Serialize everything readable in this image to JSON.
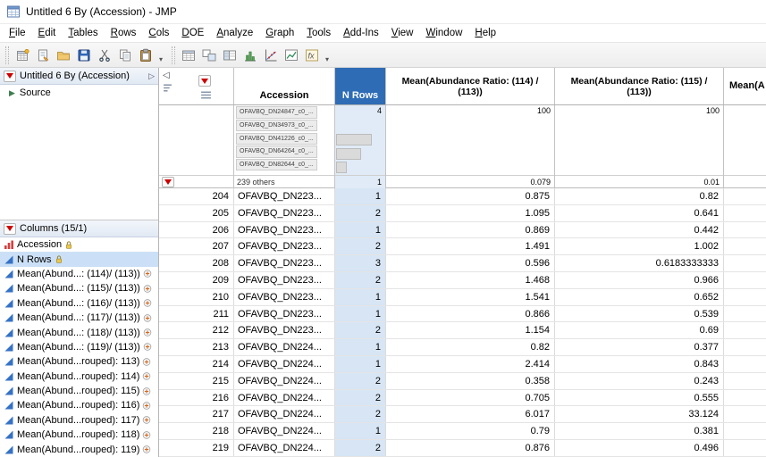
{
  "window": {
    "title": "Untitled 6 By (Accession) - JMP"
  },
  "menu": {
    "items": [
      "File",
      "Edit",
      "Tables",
      "Rows",
      "Cols",
      "DOE",
      "Analyze",
      "Graph",
      "Tools",
      "Add-Ins",
      "View",
      "Window",
      "Help"
    ]
  },
  "toolbar": {
    "group1": [
      "new-data-table",
      "new-journal",
      "open",
      "save",
      "cut",
      "copy",
      "paste"
    ],
    "group2": [
      "data-table",
      "join-tables",
      "split-columns",
      "distribution",
      "fit-y-by-x",
      "graph-builder",
      "formula"
    ]
  },
  "icons": {
    "collapse_left": "◁",
    "panel_collapse_right": "▷",
    "overflow_chevron": "▾",
    "source_marker": "▶"
  },
  "colors": {
    "nrows_header": "#2e6cb5",
    "nrows_column_bg": "#d7e5f4",
    "selection_bg": "#cbe0f6",
    "red_triangle": "#cc0000"
  },
  "sidebar": {
    "table_panel": {
      "title": "Untitled 6 By (Accession)",
      "source_label": "Source"
    },
    "columns_panel": {
      "title": "Columns (15/1)",
      "items": [
        {
          "label": "Accession",
          "type": "nominal",
          "lock": true
        },
        {
          "label": "N Rows",
          "type": "continuous",
          "lock": true,
          "selected": true
        },
        {
          "label": "Mean(Abund...: (114)/ (113))",
          "type": "continuous",
          "formula": true
        },
        {
          "label": "Mean(Abund...: (115)/ (113))",
          "type": "continuous",
          "formula": true
        },
        {
          "label": "Mean(Abund...: (116)/ (113))",
          "type": "continuous",
          "formula": true
        },
        {
          "label": "Mean(Abund...: (117)/ (113))",
          "type": "continuous",
          "formula": true
        },
        {
          "label": "Mean(Abund...: (118)/ (113))",
          "type": "continuous",
          "formula": true
        },
        {
          "label": "Mean(Abund...: (119)/ (113))",
          "type": "continuous",
          "formula": true
        },
        {
          "label": "Mean(Abund...rouped): 113)",
          "type": "continuous",
          "formula": true
        },
        {
          "label": "Mean(Abund...rouped): 114)",
          "type": "continuous",
          "formula": true
        },
        {
          "label": "Mean(Abund...rouped): 115)",
          "type": "continuous",
          "formula": true
        },
        {
          "label": "Mean(Abund...rouped): 116)",
          "type": "continuous",
          "formula": true
        },
        {
          "label": "Mean(Abund...rouped): 117)",
          "type": "continuous",
          "formula": true
        },
        {
          "label": "Mean(Abund...rouped): 118)",
          "type": "continuous",
          "formula": true
        },
        {
          "label": "Mean(Abund...rouped): 119)",
          "type": "continuous",
          "formula": true
        }
      ]
    }
  },
  "table": {
    "columns": [
      {
        "key": "rowstate",
        "label": ""
      },
      {
        "key": "accession",
        "label": "Accession"
      },
      {
        "key": "nrows",
        "label": "N Rows",
        "selected": true
      },
      {
        "key": "mean_114_113",
        "label": "Mean(Abundance Ratio: (114) / (113))"
      },
      {
        "key": "mean_115_113",
        "label": "Mean(Abundance Ratio: (115) / (113))"
      },
      {
        "key": "mean_partial",
        "label": "Mean(A"
      }
    ],
    "summary": {
      "accession_top_values": [
        "OFAVBQ_DN24847_c0_...",
        "OFAVBQ_DN34973_c0_...",
        "OFAVBQ_DN41226_c0_...",
        "OFAVBQ_DN64264_c0_...",
        "OFAVBQ_DN82644_c0_..."
      ],
      "others_label": "239 others",
      "nrows": {
        "max": "4",
        "min": "1",
        "bars": [
          0,
          0,
          40,
          28,
          12
        ]
      },
      "mean114": {
        "max": "100",
        "min": "0.079"
      },
      "mean115": {
        "max": "100",
        "min": "0.01"
      }
    },
    "rows": [
      [
        "204",
        "OFAVBQ_DN223...",
        "1",
        "0.875",
        "0.82"
      ],
      [
        "205",
        "OFAVBQ_DN223...",
        "2",
        "1.095",
        "0.641"
      ],
      [
        "206",
        "OFAVBQ_DN223...",
        "1",
        "0.869",
        "0.442"
      ],
      [
        "207",
        "OFAVBQ_DN223...",
        "2",
        "1.491",
        "1.002"
      ],
      [
        "208",
        "OFAVBQ_DN223...",
        "3",
        "0.596",
        "0.6183333333"
      ],
      [
        "209",
        "OFAVBQ_DN223...",
        "2",
        "1.468",
        "0.966"
      ],
      [
        "210",
        "OFAVBQ_DN223...",
        "1",
        "1.541",
        "0.652"
      ],
      [
        "211",
        "OFAVBQ_DN223...",
        "1",
        "0.866",
        "0.539"
      ],
      [
        "212",
        "OFAVBQ_DN223...",
        "2",
        "1.154",
        "0.69"
      ],
      [
        "213",
        "OFAVBQ_DN224...",
        "1",
        "0.82",
        "0.377"
      ],
      [
        "214",
        "OFAVBQ_DN224...",
        "1",
        "2.414",
        "0.843"
      ],
      [
        "215",
        "OFAVBQ_DN224...",
        "2",
        "0.358",
        "0.243"
      ],
      [
        "216",
        "OFAVBQ_DN224...",
        "2",
        "0.705",
        "0.555"
      ],
      [
        "217",
        "OFAVBQ_DN224...",
        "2",
        "6.017",
        "33.124"
      ],
      [
        "218",
        "OFAVBQ_DN224...",
        "1",
        "0.79",
        "0.381"
      ],
      [
        "219",
        "OFAVBQ_DN224...",
        "2",
        "0.876",
        "0.496"
      ]
    ]
  }
}
